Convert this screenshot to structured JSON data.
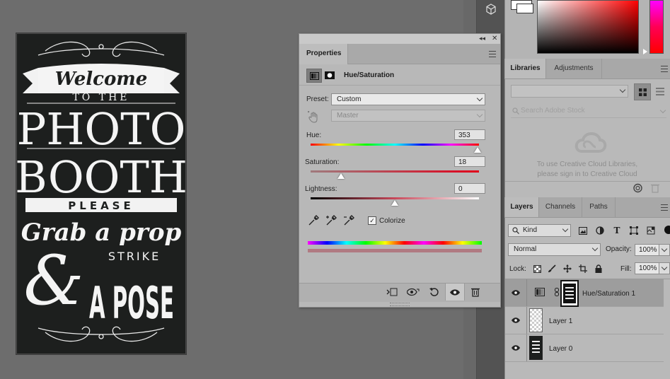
{
  "poster": {
    "line1": "Welcome",
    "line2": "TO THE",
    "line3": "PHOTO",
    "line4": "BOOTH",
    "line5": "PLEASE",
    "line6": "Grab a prop",
    "line7": "STRIKE",
    "line8": "&",
    "line9": "A POSE"
  },
  "properties": {
    "tab_label": "Properties",
    "adjustment_title": "Hue/Saturation",
    "preset_label": "Preset:",
    "preset_value": "Custom",
    "channel_value": "Master",
    "hue_label": "Hue:",
    "hue_value": "353",
    "hue_fraction": 0.99,
    "saturation_label": "Saturation:",
    "saturation_value": "18",
    "saturation_fraction": 0.18,
    "lightness_label": "Lightness:",
    "lightness_value": "0",
    "lightness_fraction": 0.5,
    "colorize_label": "Colorize",
    "colorize_checked": true
  },
  "libraries": {
    "tabs": [
      "Libraries",
      "Adjustments"
    ],
    "search_placeholder": "Search Adobe Stock",
    "message_line1": "To use Creative Cloud Libraries,",
    "message_line2": "please sign in to Creative Cloud"
  },
  "layers": {
    "tabs": [
      "Layers",
      "Channels",
      "Paths"
    ],
    "filter_kind": "Kind",
    "blend_mode": "Normal",
    "opacity_label": "Opacity:",
    "opacity_value": "100%",
    "lock_label": "Lock:",
    "fill_label": "Fill:",
    "fill_value": "100%",
    "items": [
      {
        "name": "Hue/Saturation 1"
      },
      {
        "name": "Layer 1"
      },
      {
        "name": "Layer 0"
      }
    ]
  },
  "colors": {
    "accent_red": "#d9222a",
    "panel_gray": "#b9b9b9"
  }
}
